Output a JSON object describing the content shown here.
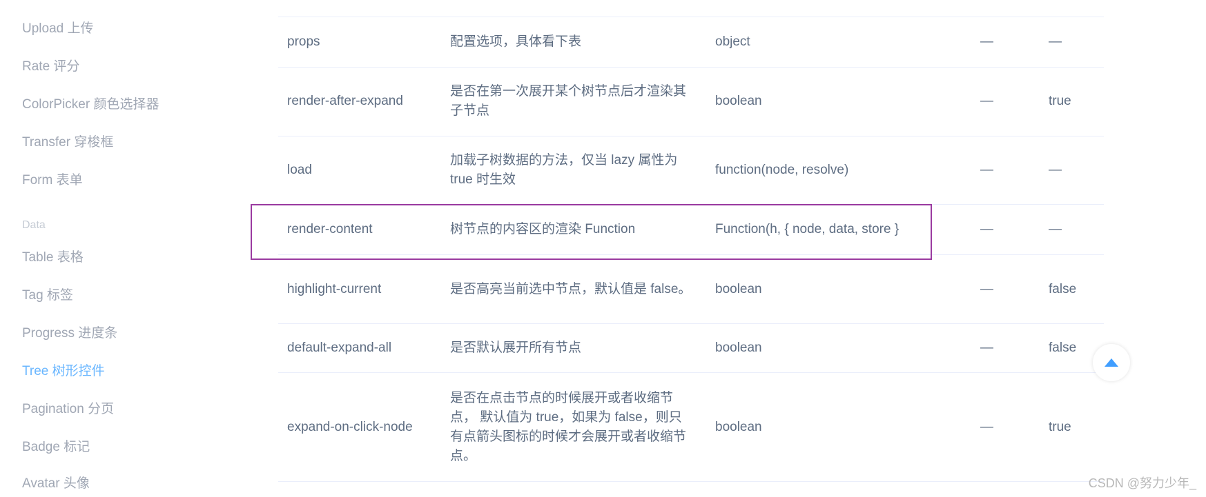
{
  "sidebar": {
    "items": [
      {
        "label": "Upload 上传"
      },
      {
        "label": "Rate 评分"
      },
      {
        "label": "ColorPicker 颜色选择器"
      },
      {
        "label": "Transfer 穿梭框"
      },
      {
        "label": "Form 表单"
      },
      {
        "label": "Table 表格"
      },
      {
        "label": "Tag 标签"
      },
      {
        "label": "Progress 进度条"
      },
      {
        "label": "Tree 树形控件"
      },
      {
        "label": "Pagination 分页"
      },
      {
        "label": "Badge 标记"
      },
      {
        "label": "Avatar 头像"
      }
    ],
    "group_label": "Data",
    "active_item": "Tree 树形控件"
  },
  "table": {
    "rows": [
      {
        "param": "props",
        "desc": "配置选项，具体看下表",
        "type": "object",
        "optional": "—",
        "default": "—"
      },
      {
        "param": "render-after-expand",
        "desc": "是否在第一次展开某个树节点后才渲染其子节点",
        "type": "boolean",
        "optional": "—",
        "default": "true"
      },
      {
        "param": "load",
        "desc": "加载子树数据的方法，仅当 lazy 属性为true 时生效",
        "type": "function(node, resolve)",
        "optional": "—",
        "default": "—"
      },
      {
        "param": "render-content",
        "desc": "树节点的内容区的渲染 Function",
        "type": "Function(h, { node, data, store }",
        "optional": "—",
        "default": "—"
      },
      {
        "param": "highlight-current",
        "desc": "是否高亮当前选中节点，默认值是 false。",
        "type": "boolean",
        "optional": "—",
        "default": "false"
      },
      {
        "param": "default-expand-all",
        "desc": "是否默认展开所有节点",
        "type": "boolean",
        "optional": "—",
        "default": "false"
      },
      {
        "param": "expand-on-click-node",
        "desc": "是否在点击节点的时候展开或者收缩节点， 默认值为 true，如果为 false，则只有点箭头图标的时候才会展开或者收缩节点。",
        "type": "boolean",
        "optional": "—",
        "default": "true"
      }
    ]
  },
  "highlight_color": "#9a3aa0",
  "accent_color": "#409eff",
  "back_to_top_icon": "caret-up-icon",
  "watermark": "CSDN @努力少年_"
}
